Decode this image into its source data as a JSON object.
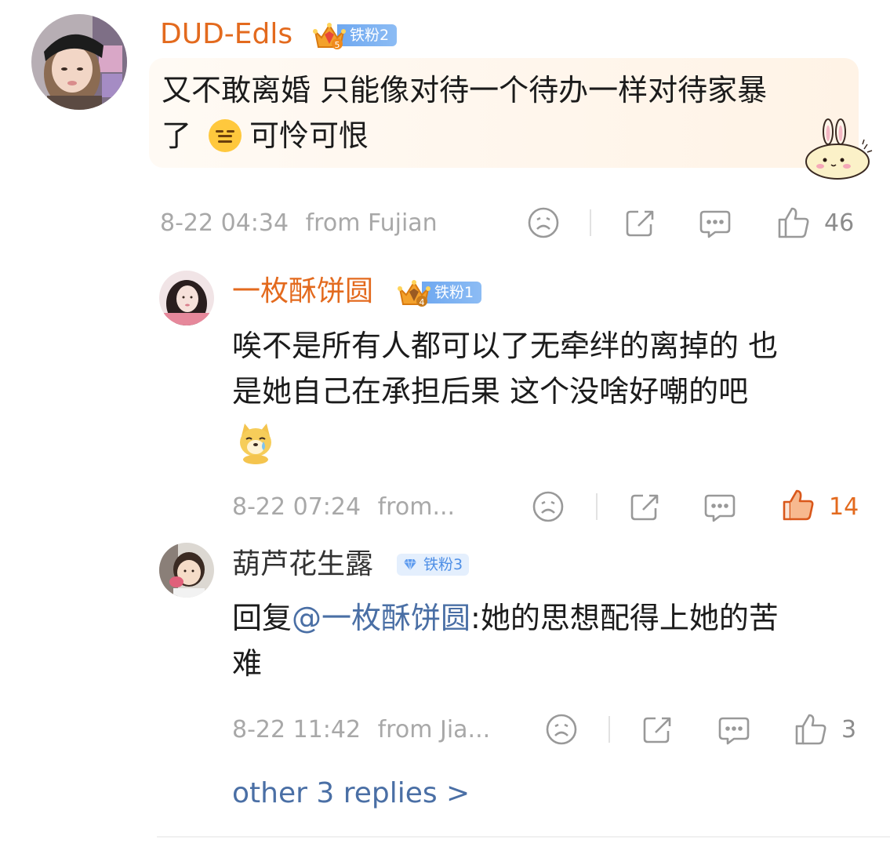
{
  "comments": [
    {
      "username": "DUD-Edls",
      "badge_label": "铁粉2",
      "badge_level": "5",
      "text_line1": "又不敢离婚 只能像对待一个待办一样对待家暴",
      "text_line2_a": "了",
      "text_line2_emoji": "expressionless-emoji",
      "text_line2_b": "可怜可恨",
      "timestamp": "8-22 04:34",
      "location": "from Fujian",
      "like_count": "46"
    },
    {
      "username": "一枚酥饼圆",
      "badge_label": "铁粉1",
      "badge_level": "4",
      "text_line1": "唉不是所有人都可以了无牵绊的离掉的 也",
      "text_line2": "是她自己在承担后果 这个没啥好嘲的吧",
      "emoji": "crying-doge-emoji",
      "timestamp": "8-22 07:24",
      "location": "from...",
      "like_count": "14",
      "liked": true
    },
    {
      "username": "葫芦花生露",
      "badge_label": "铁粉3",
      "reply_prefix": "回复",
      "mention": "@一枚酥饼圆",
      "text_after_mention": ":她的思想配得上她的苦",
      "text_line2": "难",
      "timestamp": "8-22 11:42",
      "location": "from Jia...",
      "like_count": "3"
    }
  ],
  "more_replies_label": "other 3 replies >",
  "icons": {
    "dislike": "sad-face-icon",
    "share": "share-icon",
    "comment": "comment-bubble-icon",
    "like": "thumbs-up-icon"
  },
  "colors": {
    "username_vip": "#e36a1e",
    "mention": "#4a6fa5",
    "meta_text": "#a8a8a8",
    "liked": "#e36a1e",
    "badge_blue": "#6fa8f0"
  }
}
